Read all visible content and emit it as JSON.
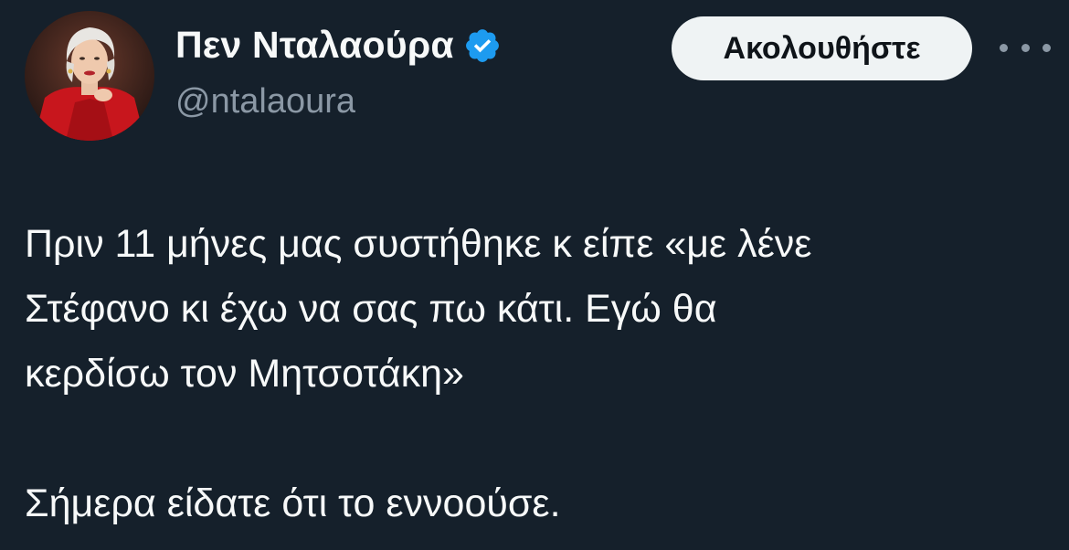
{
  "author": {
    "display_name": "Πεν Νταλαούρα",
    "handle": "@ntalaoura",
    "verified": true,
    "verified_color": "#1d9bf0"
  },
  "actions": {
    "follow_label": "Ακολουθήστε",
    "more_icon": "ellipsis-icon"
  },
  "tweet": {
    "lines": [
      "Πριν 11 μήνες μας συστήθηκε κ είπε «με λένε",
      "Στέφανο κι έχω να σας πω κάτι. Εγώ θα",
      "κερδίσω τον Μητσοτάκη»",
      "Σήμερα είδατε ότι το εννοούσε."
    ]
  },
  "colors": {
    "background": "#15202b",
    "text": "#f7f9f9",
    "secondary_text": "#8b98a5",
    "button_bg": "#eff3f4"
  }
}
